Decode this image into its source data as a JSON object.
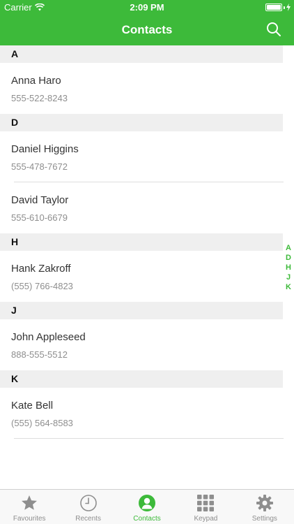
{
  "status_bar": {
    "carrier": "Carrier",
    "time": "2:09 PM"
  },
  "nav": {
    "title": "Contacts",
    "search_icon": "search-icon"
  },
  "sections": [
    {
      "letter": "A",
      "contacts": [
        {
          "name": "Anna Haro",
          "phone": "555-522-8243"
        }
      ]
    },
    {
      "letter": "D",
      "contacts": [
        {
          "name": "Daniel Higgins",
          "phone": "555-478-7672"
        },
        {
          "name": "David Taylor",
          "phone": "555-610-6679"
        }
      ]
    },
    {
      "letter": "H",
      "contacts": [
        {
          "name": "Hank Zakroff",
          "phone": "(555) 766-4823"
        }
      ]
    },
    {
      "letter": "J",
      "contacts": [
        {
          "name": "John Appleseed",
          "phone": "888-555-5512"
        }
      ]
    },
    {
      "letter": "K",
      "contacts": [
        {
          "name": "Kate Bell",
          "phone": "(555) 564-8583"
        }
      ]
    }
  ],
  "index_letters": [
    "A",
    "D",
    "H",
    "J",
    "K"
  ],
  "tabs": [
    {
      "label": "Favourites",
      "icon": "star-icon",
      "active": false
    },
    {
      "label": "Recents",
      "icon": "clock-icon",
      "active": false
    },
    {
      "label": "Contacts",
      "icon": "person-icon",
      "active": true
    },
    {
      "label": "Keypad",
      "icon": "keypad-icon",
      "active": false
    },
    {
      "label": "Settings",
      "icon": "gear-icon",
      "active": false
    }
  ],
  "colors": {
    "accent": "#3dba3a",
    "section_bg": "#efefef",
    "inactive_tab": "#8e8e8e"
  }
}
